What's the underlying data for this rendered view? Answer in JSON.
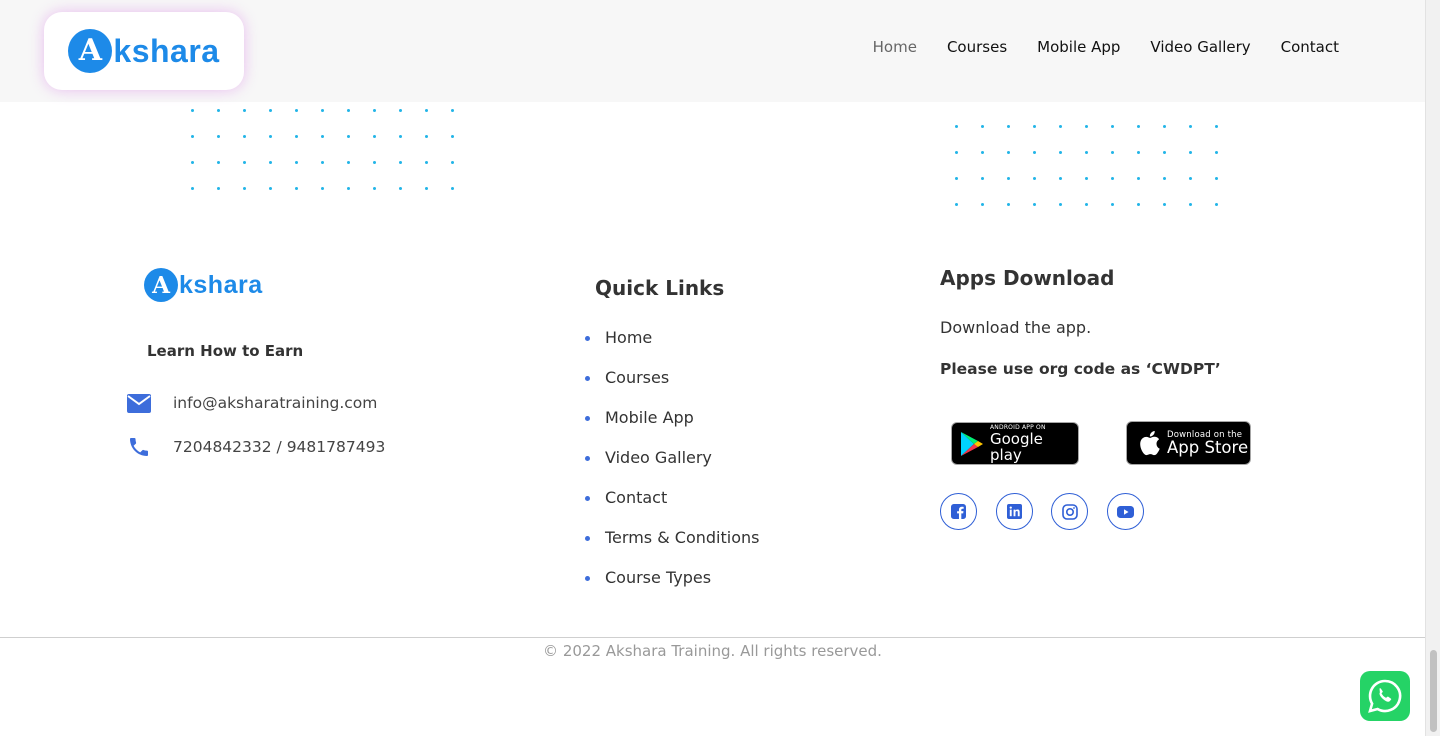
{
  "brand": {
    "logo_letter": "A",
    "logo_text": "kshara",
    "color": "#1d8ae8"
  },
  "nav": {
    "items": [
      {
        "label": "Home",
        "active": true
      },
      {
        "label": "Courses"
      },
      {
        "label": "Mobile App"
      },
      {
        "label": "Video Gallery"
      },
      {
        "label": "Contact"
      }
    ]
  },
  "footer": {
    "tagline": "Learn How to Earn",
    "email": "info@aksharatraining.com",
    "phone": "7204842332 / 9481787493",
    "quick_links": {
      "title": "Quick Links",
      "items": [
        "Home",
        "Courses",
        "Mobile App",
        "Video Gallery",
        "Contact",
        "Terms & Conditions",
        "Course Types"
      ]
    },
    "apps": {
      "title": "Apps Download",
      "description": "Download the app.",
      "note": "Please use org code as ‘CWDPT’",
      "google_play": {
        "small": "Android App on",
        "big": "Google play"
      },
      "app_store": {
        "small": "Download on the",
        "big": "App Store"
      }
    },
    "social_icons": [
      "facebook-icon",
      "linkedin-icon",
      "instagram-icon",
      "youtube-icon"
    ],
    "copyright": "© 2022 Akshara Training. All rights reserved."
  },
  "colors": {
    "accent": "#1d8ae8",
    "dots": "#23b5e8",
    "bullet": "#3d6ddb",
    "whatsapp": "#25d366"
  }
}
